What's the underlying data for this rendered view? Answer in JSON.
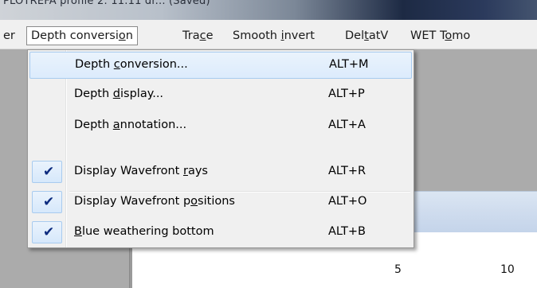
{
  "window": {
    "title": "PLOTREFA profile 2: 11.11 dr... (Saved)"
  },
  "menubar": {
    "items": [
      {
        "label": "er"
      },
      {
        "label": "Depth conversion"
      },
      {
        "label": "Trace"
      },
      {
        "label": "Smooth invert"
      },
      {
        "label": "DeltatV"
      },
      {
        "label": "WET Tomo"
      }
    ]
  },
  "dropdown": {
    "items": [
      {
        "label": "Depth conversion...",
        "shortcut": "ALT+M",
        "checked": false,
        "highlighted": true
      },
      {
        "label": "Depth display...",
        "shortcut": "ALT+P",
        "checked": false
      },
      {
        "label": "Depth annotation...",
        "shortcut": "ALT+A",
        "checked": false
      },
      {
        "label": "Display Wavefront rays",
        "shortcut": "ALT+R",
        "checked": true
      },
      {
        "label": "Display Wavefront positions",
        "shortcut": "ALT+O",
        "checked": true
      },
      {
        "label": "Blue weathering bottom",
        "shortcut": "ALT+B",
        "checked": true
      }
    ],
    "check_icon": "✔"
  },
  "background": {
    "tick_labels": [
      "5",
      "10"
    ]
  },
  "colors": {
    "highlight_fill": "#dcebfc",
    "highlight_border": "#a8cbef",
    "check": "#0b2a7e"
  }
}
